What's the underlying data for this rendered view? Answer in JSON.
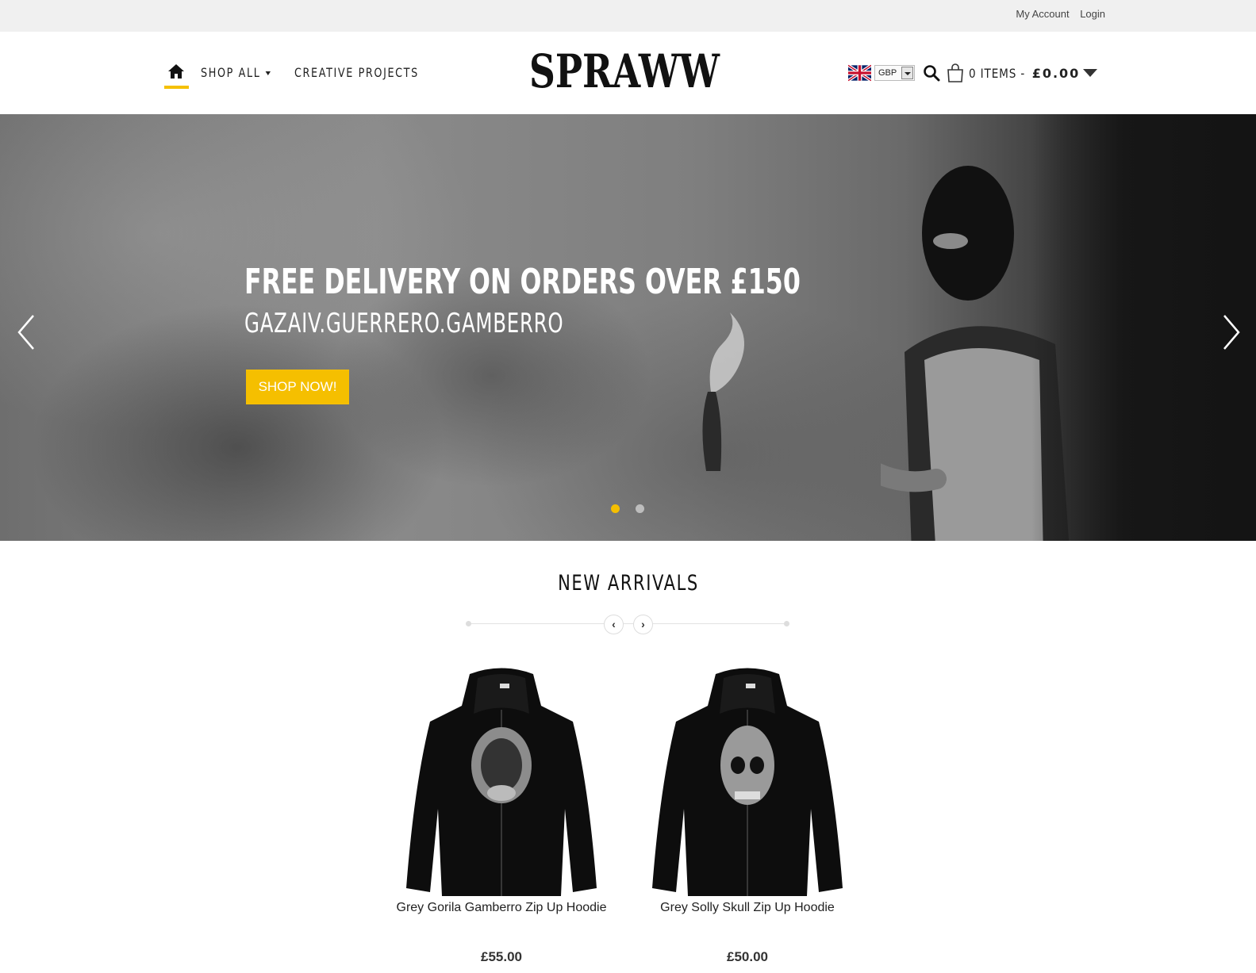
{
  "topbar": {
    "my_account": "My Account",
    "login": "Login"
  },
  "nav": {
    "home_icon": "home-icon",
    "items": [
      {
        "label": "SHOP ALL",
        "has_dropdown": true
      },
      {
        "label": "CREATIVE PROJECTS",
        "has_dropdown": false
      }
    ],
    "active_color": "#f5c000"
  },
  "logo": {
    "text": "SPRAWW"
  },
  "header_right": {
    "flag_icon": "uk-flag-icon",
    "currency": "GBP",
    "search_icon": "search-icon",
    "cart_icon": "shopping-bag-icon",
    "cart_items": "0 ITEMS -",
    "cart_total": "£0.00"
  },
  "hero": {
    "title": "FREE DELIVERY ON ORDERS OVER £150",
    "subtitle": "GAZAIV.GUERRERO.GAMBERRO",
    "button_label": "SHOP NOW!",
    "button_color": "#f5bf00",
    "slides": [
      {
        "active": true
      },
      {
        "active": false
      }
    ],
    "active_dot_color": "#f5bf00",
    "inactive_dot_color": "#bdbdbd"
  },
  "new_arrivals": {
    "title": "NEW ARRIVALS",
    "prev_label": "‹",
    "next_label": "›",
    "products": [
      {
        "name": "Grey Gorila Gamberro Zip Up Hoodie",
        "price": "£55.00",
        "print": "gorilla"
      },
      {
        "name": "Grey Solly Skull Zip Up Hoodie",
        "price": "£50.00",
        "print": "skull"
      }
    ]
  }
}
